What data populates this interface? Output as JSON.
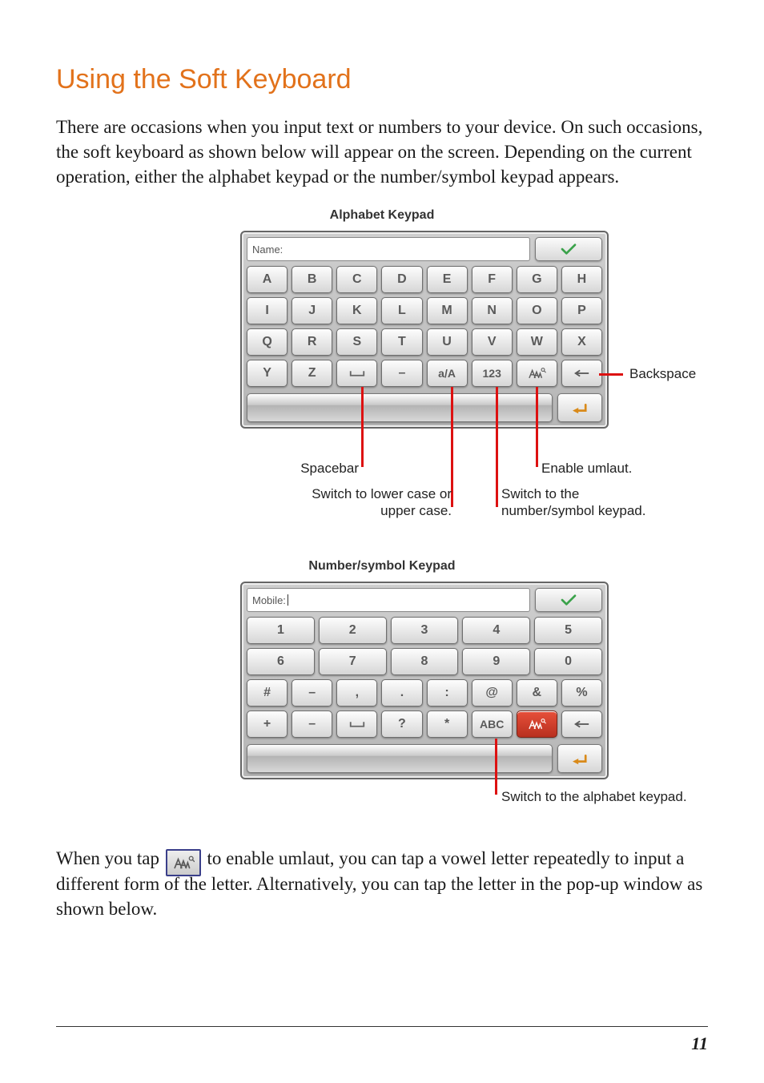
{
  "title": "Using the Soft Keyboard",
  "intro": "There are occasions when you input text or numbers to your device. On such occasions, the soft keyboard as shown below will appear on the screen. Depending on the current operation, either the alphabet keypad or the number/symbol keypad appears.",
  "captions": {
    "alpha": "Alphabet Keypad",
    "numsym": "Number/symbol Keypad"
  },
  "alpha": {
    "field_label": "Name:",
    "rows": {
      "r1": [
        "A",
        "B",
        "C",
        "D",
        "E",
        "F",
        "G",
        "H"
      ],
      "r2": [
        "I",
        "J",
        "K",
        "L",
        "M",
        "N",
        "O",
        "P"
      ],
      "r3": [
        "Q",
        "R",
        "S",
        "T",
        "U",
        "V",
        "W",
        "X"
      ]
    },
    "row4": {
      "y": "Y",
      "z": "Z",
      "dash": "–",
      "case": "a/A",
      "num": "123"
    },
    "callouts": {
      "spacebar": "Spacebar",
      "case": "Switch to lower case or upper case.",
      "backspace": "Backspace",
      "umlaut": "Enable umlaut.",
      "numpad": "Switch to the number/symbol keypad."
    }
  },
  "num": {
    "field_label": "Mobile:",
    "top": [
      "1",
      "2",
      "3",
      "4",
      "5",
      "6",
      "7",
      "8",
      "9",
      "0"
    ],
    "sym1": [
      "#",
      "–",
      ",",
      ".",
      ":",
      "@",
      "&",
      "%"
    ],
    "sym2": {
      "plus": "+",
      "minus": "–",
      "qmark": "?",
      "star": "*",
      "abc": "ABC"
    },
    "callout": "Switch to the alphabet keypad."
  },
  "trailing": {
    "pre": "When you tap ",
    "post": " to enable umlaut, you can tap a vowel letter repeatedly to input a different form of the letter. Alternatively, you can tap the letter in the pop-up window as shown below."
  },
  "page_number": "11"
}
